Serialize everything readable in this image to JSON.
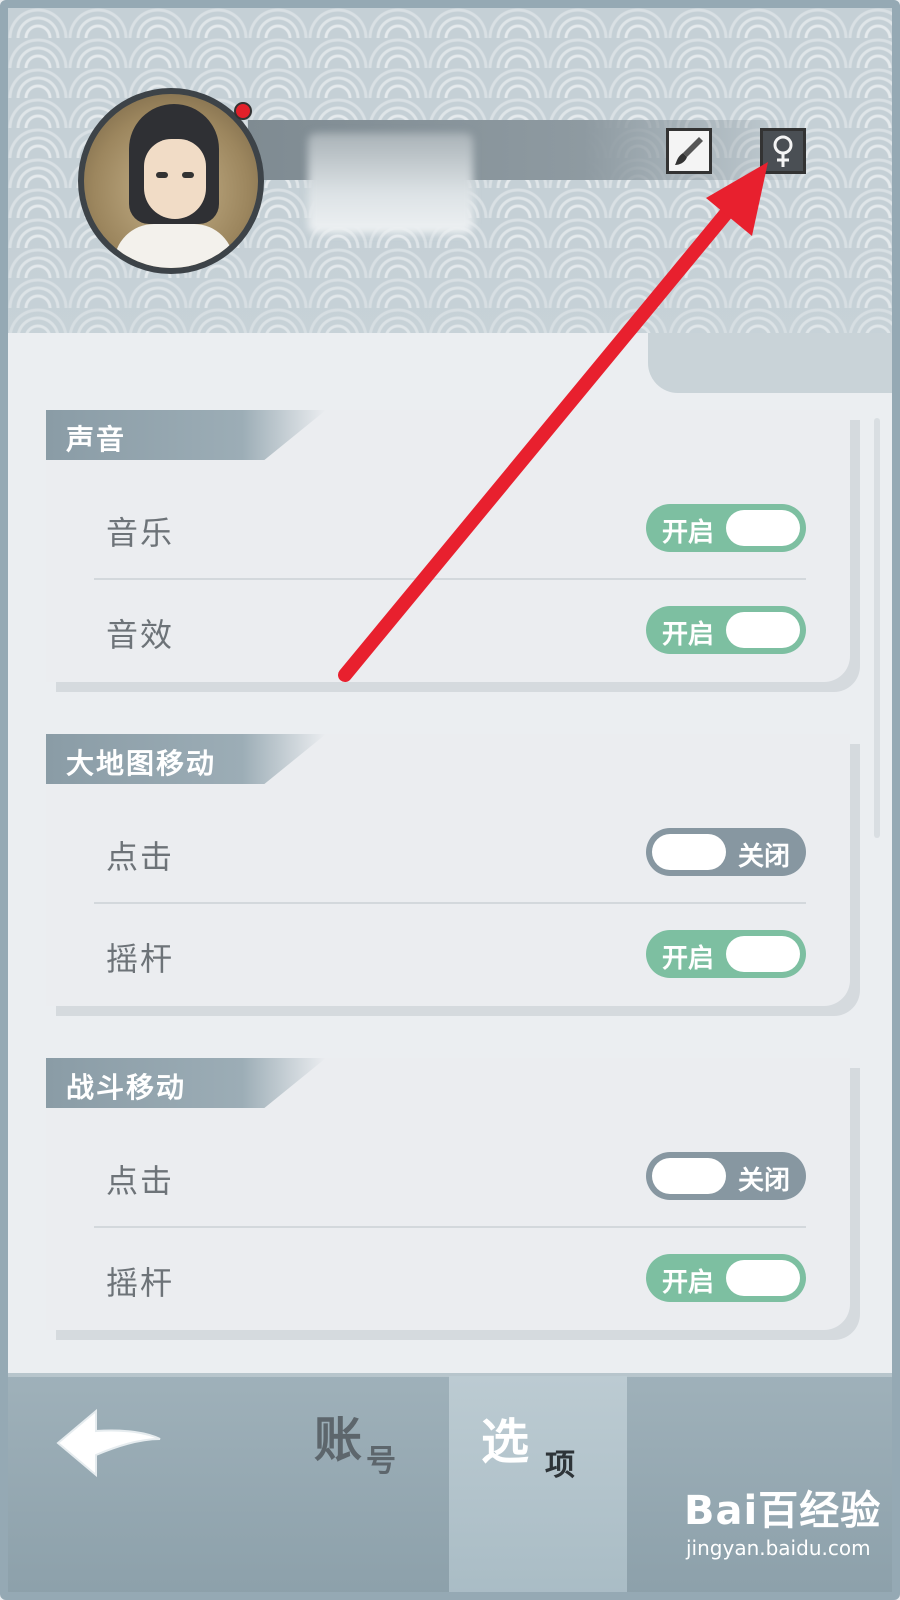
{
  "header": {
    "edit_icon": "brush-icon",
    "gender_icon": "female-symbol-icon"
  },
  "sections": [
    {
      "title": "声音",
      "rows": [
        {
          "label": "音乐",
          "toggle_text": "开启",
          "state": "on"
        },
        {
          "label": "音效",
          "toggle_text": "开启",
          "state": "on"
        }
      ]
    },
    {
      "title": "大地图移动",
      "rows": [
        {
          "label": "点击",
          "toggle_text": "关闭",
          "state": "off"
        },
        {
          "label": "摇杆",
          "toggle_text": "开启",
          "state": "on"
        }
      ]
    },
    {
      "title": "战斗移动",
      "rows": [
        {
          "label": "点击",
          "toggle_text": "关闭",
          "state": "off"
        },
        {
          "label": "摇杆",
          "toggle_text": "开启",
          "state": "on"
        }
      ]
    }
  ],
  "bottom_bar": {
    "tabs": [
      {
        "big": "账",
        "small": "号",
        "active": false
      },
      {
        "big": "选",
        "small": "项",
        "active": true
      }
    ]
  },
  "watermark": {
    "logo": "Bai百经验",
    "url": "jingyan.baidu.com"
  },
  "colors": {
    "toggle_on": "#7dbfa1",
    "toggle_off": "#8797a1",
    "annotation_arrow": "#e8202e",
    "notification_dot": "#e2202a"
  }
}
